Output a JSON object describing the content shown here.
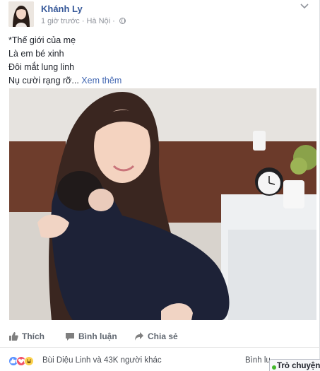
{
  "post": {
    "author": "Khánh Ly",
    "time": "1 giờ trước",
    "separator": "·",
    "location": "Hà Nội",
    "lines": [
      "*Thế giới của mẹ",
      "Là em bé xinh",
      "Đôi mắt lung linh",
      "Nụ cười rạng rỡ..."
    ],
    "see_more": "Xem thêm"
  },
  "actions": {
    "like": "Thích",
    "comment": "Bình luận",
    "share": "Chia sẻ"
  },
  "reactions": {
    "summary": "Bùi Diệu Linh và 43K người khác",
    "comments_link": "Bình lu",
    "icons": [
      "like-icon",
      "love-icon",
      "haha-icon"
    ],
    "colors": {
      "like": "#5890ff",
      "love": "#f25268",
      "haha": "#fbd14b"
    }
  },
  "chat": {
    "label": "Trò chuyện"
  },
  "colors": {
    "link": "#365899",
    "see_more": "#4267b2",
    "muted": "#90949c",
    "action": "#606770"
  }
}
